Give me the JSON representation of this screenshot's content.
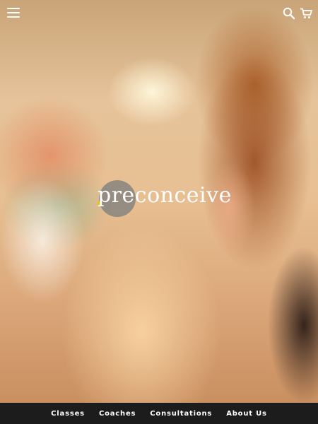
{
  "header": {
    "menu_icon": "hamburger-menu-icon",
    "search_icon": "search-icon",
    "cart_icon": "shopping-cart-icon"
  },
  "logo": {
    "text": "preconceive",
    "accent_color": "#f2c400",
    "circle_color": "#7d7d7d"
  },
  "nav": {
    "items": [
      {
        "label": "Classes"
      },
      {
        "label": "Coaches"
      },
      {
        "label": "Consultations"
      },
      {
        "label": "About Us"
      }
    ],
    "background": "#1c1c1c"
  }
}
